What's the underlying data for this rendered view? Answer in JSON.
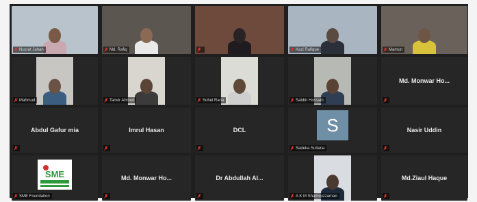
{
  "app": "Zoom",
  "tiles": [
    {
      "id": "t1",
      "name": "Nusrat Jahan",
      "kind": "video",
      "active": false,
      "bg": "#b9c3cc",
      "head": "#7a5a47",
      "body": "#c9a8b0"
    },
    {
      "id": "t2",
      "name": "Md. Rafiq",
      "kind": "video",
      "active": false,
      "bg": "#5b5750",
      "head": "#8a6a52",
      "body": "#e9e9e9"
    },
    {
      "id": "t3",
      "name": "",
      "kind": "video",
      "active": true,
      "bg": "#6d4a3c",
      "head": "#2a2326",
      "body": "#1f1b1e"
    },
    {
      "id": "t4",
      "name": "Kazi Rafique",
      "kind": "video",
      "active": false,
      "bg": "#a9b5c0",
      "head": "#5a4a40",
      "body": "#2b2f3a"
    },
    {
      "id": "t5",
      "name": "Mamun",
      "kind": "video",
      "active": false,
      "bg": "#6a625a",
      "head": "#6e5646",
      "body": "#d8c23a"
    },
    {
      "id": "t6",
      "name": "Mahmud",
      "kind": "video",
      "active": false,
      "bg": "#c8c6c2",
      "head": "#6a5244",
      "body": "#3a5d80"
    },
    {
      "id": "t7",
      "name": "Tanvir Ahmed",
      "kind": "video",
      "active": false,
      "bg": "#d9d6cf",
      "head": "#5a4436",
      "body": "#3b3b3b"
    },
    {
      "id": "t8",
      "name": "Sohel Rana",
      "kind": "video",
      "active": false,
      "bg": "#dcdcd6",
      "head": "#5e4838",
      "body": "#cfcfcf"
    },
    {
      "id": "t9",
      "name": "Sabbir Hossain",
      "kind": "video",
      "active": false,
      "bg": "#b7b9b4",
      "head": "#5a4334",
      "body": "#2f3e52"
    },
    {
      "id": "t10",
      "name": "Md. Monwar Ho...",
      "kind": "name",
      "active": false
    },
    {
      "id": "t11",
      "name": "Abdul Gafur mia",
      "kind": "name",
      "active": false
    },
    {
      "id": "t12",
      "name": "Imrul Hasan",
      "kind": "name",
      "active": false
    },
    {
      "id": "t13",
      "name": "DCL",
      "kind": "name",
      "active": false
    },
    {
      "id": "t14",
      "name": "Sadeka Sultana",
      "kind": "avatar",
      "initial": "S",
      "active": false
    },
    {
      "id": "t15",
      "name": "Nasir Uddin",
      "kind": "name",
      "active": false
    },
    {
      "id": "t16",
      "name": "SME Foundation",
      "kind": "logo",
      "logo_text": "SME",
      "active": false
    },
    {
      "id": "t17",
      "name": "Md. Monwar Ho...",
      "kind": "name",
      "active": false
    },
    {
      "id": "t18",
      "name": "Dr Abdullah Al...",
      "kind": "name",
      "active": false
    },
    {
      "id": "t19",
      "name": "A K M Shamsuzzaman",
      "kind": "video",
      "active": false,
      "bg": "#d9dde2",
      "head": "#4b3a30",
      "body": "#1e2a3c"
    },
    {
      "id": "t20",
      "name": "Md.Ziaul Haque",
      "kind": "name",
      "active": false
    }
  ],
  "colors": {
    "mic_muted": "#e0342c",
    "active_border": "#c8d640",
    "logo_green": "#2f9a3c",
    "logo_red": "#d3312b"
  }
}
